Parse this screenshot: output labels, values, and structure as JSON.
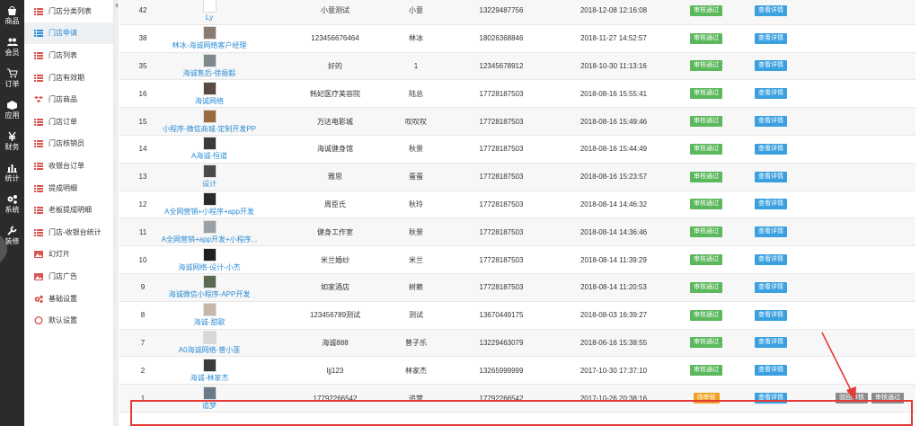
{
  "rail": [
    {
      "label": "商品",
      "icon": "bag-icon"
    },
    {
      "label": "会员",
      "icon": "users-icon"
    },
    {
      "label": "订单",
      "icon": "cart-icon"
    },
    {
      "label": "应用",
      "icon": "cube-icon"
    },
    {
      "label": "财务",
      "icon": "yen-icon"
    },
    {
      "label": "统计",
      "icon": "bar-chart-icon"
    },
    {
      "label": "系统",
      "icon": "gears-icon"
    },
    {
      "label": "装修",
      "icon": "wrench-icon"
    }
  ],
  "sidebar": [
    {
      "label": "门店分类列表",
      "icon": "list-icon",
      "active": false
    },
    {
      "label": "门店申请",
      "icon": "list-icon",
      "active": true
    },
    {
      "label": "门店列表",
      "icon": "list-icon",
      "active": false
    },
    {
      "label": "门店有效期",
      "icon": "list-icon",
      "active": false
    },
    {
      "label": "门店商品",
      "icon": "cubes-icon",
      "active": false
    },
    {
      "label": "门店订单",
      "icon": "list-icon",
      "active": false
    },
    {
      "label": "门店核销员",
      "icon": "list-icon",
      "active": false
    },
    {
      "label": "收银台订单",
      "icon": "list-icon",
      "active": false
    },
    {
      "label": "提成明细",
      "icon": "list-icon",
      "active": false
    },
    {
      "label": "老板提成明细",
      "icon": "list-icon",
      "active": false
    },
    {
      "label": "门店-收银台统计",
      "icon": "list-icon",
      "active": false
    },
    {
      "label": "幻灯片",
      "icon": "image-icon",
      "active": false
    },
    {
      "label": "门店广告",
      "icon": "image-icon",
      "active": false
    },
    {
      "label": "基础设置",
      "icon": "gears-icon",
      "active": false
    },
    {
      "label": "默认设置",
      "icon": "circle-icon",
      "active": false
    }
  ],
  "rows": [
    {
      "id": "42",
      "store": "Ly",
      "phone1": "小意测试",
      "name": "小意",
      "phone2": "13229487756",
      "time": "2018-12-08 12:16:08",
      "status": "审核通过",
      "detail": "查看详情",
      "thumb": "#ffffff"
    },
    {
      "id": "38",
      "store": "林冰-海诚网络客户经理",
      "phone1": "123456676464",
      "name": "林冰",
      "phone2": "18026368846",
      "time": "2018-11-27 14:52:57",
      "status": "审核通过",
      "detail": "查看详情",
      "thumb": "#8a7a70"
    },
    {
      "id": "35",
      "store": "海诚售后-徐振毅",
      "phone1": "好的",
      "name": "1",
      "phone2": "12345678912",
      "time": "2018-10-30 11:13:16",
      "status": "审核通过",
      "detail": "查看详情",
      "thumb": "#7f8a8c"
    },
    {
      "id": "16",
      "store": "海诚网络",
      "phone1": "韩妃医疗美容院",
      "name": "陆总",
      "phone2": "17728187503",
      "time": "2018-08-16 15:55:41",
      "status": "审核通过",
      "detail": "查看详情",
      "thumb": "#5a4a42"
    },
    {
      "id": "15",
      "store": "小程序-微信商城-定制开发PP",
      "phone1": "万达电影城",
      "name": "叹叹叹",
      "phone2": "17728187503",
      "time": "2018-08-16 15:49:46",
      "status": "审核通过",
      "detail": "查看详情",
      "thumb": "#9a6a40"
    },
    {
      "id": "14",
      "store": "A海诚-恒道",
      "phone1": "海诚健身馆",
      "name": "秋景",
      "phone2": "17728187503",
      "time": "2018-08-16 15:44:49",
      "status": "审核通过",
      "detail": "查看详情",
      "thumb": "#3a3a3a"
    },
    {
      "id": "13",
      "store": "设计",
      "phone1": "雅思",
      "name": "蛋蛋",
      "phone2": "17728187503",
      "time": "2018-08-16 15:23:57",
      "status": "审核通过",
      "detail": "查看详情",
      "thumb": "#4a4a4a"
    },
    {
      "id": "12",
      "store": "A全网营销+小程序+app开发",
      "phone1": "周臣氏",
      "name": "秋玲",
      "phone2": "17728187503",
      "time": "2018-08-14 14:46:32",
      "status": "审核通过",
      "detail": "查看详情",
      "thumb": "#2a2a2a"
    },
    {
      "id": "11",
      "store": "A全网营销+app开发+小程序...",
      "phone1": "健身工作室",
      "name": "秋景",
      "phone2": "17728187503",
      "time": "2018-08-14 14:36:46",
      "status": "审核通过",
      "detail": "查看详情",
      "thumb": "#9aa2a8"
    },
    {
      "id": "10",
      "store": "海诚网络-设计-小杰",
      "phone1": "米兰婚纱",
      "name": "米兰",
      "phone2": "17728187503",
      "time": "2018-08-14 11:39:29",
      "status": "审核通过",
      "detail": "查看详情",
      "thumb": "#202020"
    },
    {
      "id": "9",
      "store": "海诚微信小程序-APP开发",
      "phone1": "如家酒店",
      "name": "树赖",
      "phone2": "17728187503",
      "time": "2018-08-14 11:20:53",
      "status": "审核通过",
      "detail": "查看详情",
      "thumb": "#5a6a50"
    },
    {
      "id": "8",
      "store": "海诚-甜歌",
      "phone1": "123456789测试",
      "name": "测试",
      "phone2": "13670449175",
      "time": "2018-08-03 16:39:27",
      "status": "审核通过",
      "detail": "查看详情",
      "thumb": "#c8b8a8"
    },
    {
      "id": "7",
      "store": "A0海诚网络-曾小莲",
      "phone1": "海诚888",
      "name": "曾子乐",
      "phone2": "13229463079",
      "time": "2018-06-16 15:38:55",
      "status": "审核通过",
      "detail": "查看详情",
      "thumb": "#d8d8d8"
    },
    {
      "id": "2",
      "store": "海诚-林家杰",
      "phone1": "ljj123",
      "name": "林家杰",
      "phone2": "13265999999",
      "time": "2017-10-30 17:37:10",
      "status": "审核通过",
      "detail": "查看详情",
      "thumb": "#3a3a3a"
    },
    {
      "id": "1",
      "store": "追梦",
      "phone1": "17792266542",
      "name": "追梦",
      "phone2": "17792266542",
      "time": "2017-10-26 20:38:16",
      "status": "待审核",
      "detail": "查看详情",
      "thumb": "#6a7a8a",
      "pending": true,
      "reject": "驳回审核",
      "approve": "审核通过"
    }
  ],
  "colors": {
    "green": "#5cb85c",
    "blue": "#3aa0e0",
    "orange": "#f0a020",
    "grey": "#8a8a8a",
    "highlight": "#e53935",
    "link": "#2a8bd5"
  }
}
